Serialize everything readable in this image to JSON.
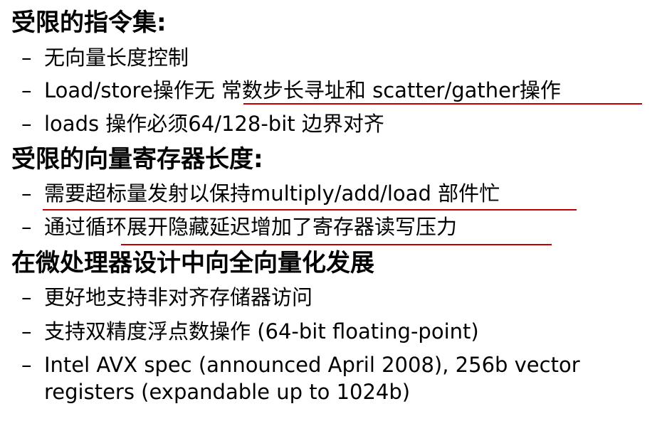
{
  "sections": [
    {
      "heading": "受限的指令集:",
      "bullets": [
        {
          "dash": "–",
          "text": "无向量长度控制"
        },
        {
          "dash": "–",
          "text": "Load/store操作无 常数步长寻址和 scatter/gather操作"
        },
        {
          "dash": "–",
          "text": "loads 操作必须64/128-bit 边界对齐"
        }
      ]
    },
    {
      "heading": "受限的向量寄存器长度:",
      "bullets": [
        {
          "dash": "–",
          "text": "需要超标量发射以保持multiply/add/load 部件忙"
        },
        {
          "dash": "–",
          "text": "通过循环展开隐藏延迟增加了寄存器读写压力"
        }
      ]
    },
    {
      "heading": "在微处理器设计中向全向量化发展",
      "bullets": [
        {
          "dash": "–",
          "text": "更好地支持非对齐存储器访问"
        },
        {
          "dash": "–",
          "text": "支持双精度浮点数操作 (64-bit floating-point)"
        },
        {
          "dash": "–",
          "text": "Intel AVX spec (announced April 2008), 256b vector registers (expandable up to 1024b)"
        }
      ]
    }
  ],
  "annotation_color": "#c00000"
}
